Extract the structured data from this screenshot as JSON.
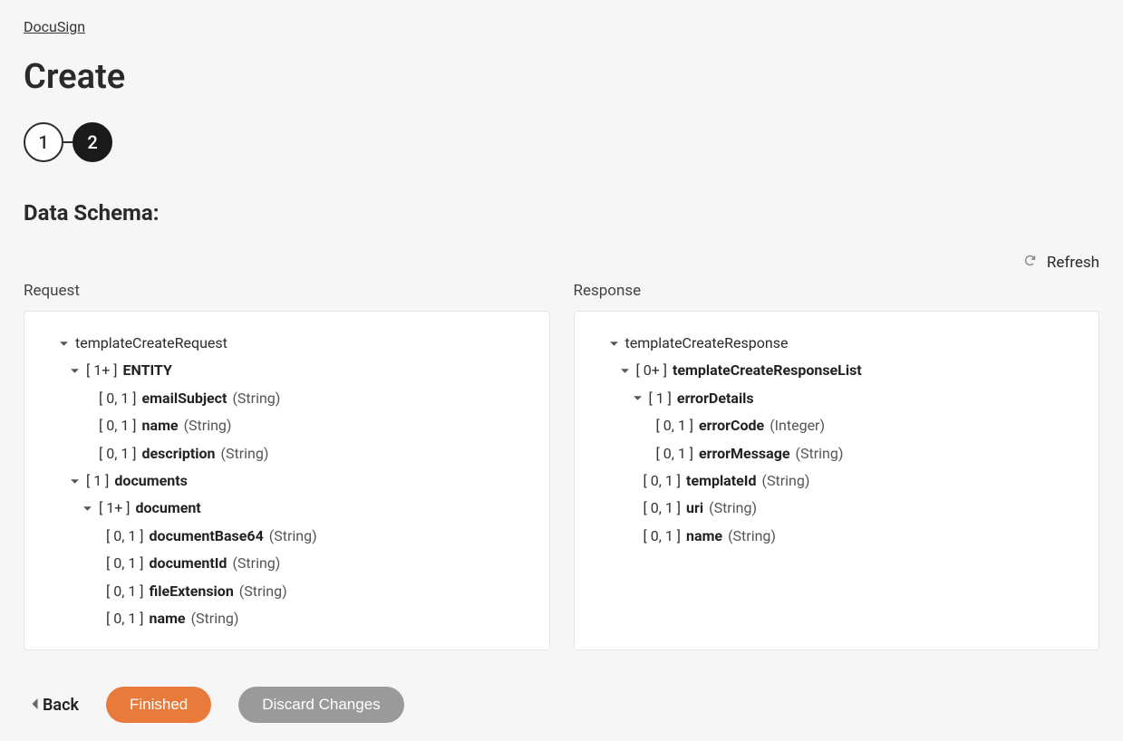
{
  "breadcrumb": "DocuSign",
  "page_title": "Create",
  "steps": [
    "1",
    "2"
  ],
  "section_title": "Data Schema:",
  "refresh_label": "Refresh",
  "columns": {
    "request_label": "Request",
    "response_label": "Response"
  },
  "request_tree": {
    "root": "templateCreateRequest",
    "entity_card": "[ 1+ ]",
    "entity_name": "ENTITY",
    "fields": [
      {
        "card": "[ 0, 1 ]",
        "name": "emailSubject",
        "type": "(String)"
      },
      {
        "card": "[ 0, 1 ]",
        "name": "name",
        "type": "(String)"
      },
      {
        "card": "[ 0, 1 ]",
        "name": "description",
        "type": "(String)"
      }
    ],
    "documents_card": "[ 1 ]",
    "documents_name": "documents",
    "document_card": "[ 1+ ]",
    "document_name": "document",
    "doc_fields": [
      {
        "card": "[ 0, 1 ]",
        "name": "documentBase64",
        "type": "(String)"
      },
      {
        "card": "[ 0, 1 ]",
        "name": "documentId",
        "type": "(String)"
      },
      {
        "card": "[ 0, 1 ]",
        "name": "fileExtension",
        "type": "(String)"
      },
      {
        "card": "[ 0, 1 ]",
        "name": "name",
        "type": "(String)"
      }
    ]
  },
  "response_tree": {
    "root": "templateCreateResponse",
    "list_card": "[ 0+ ]",
    "list_name": "templateCreateResponseList",
    "error_card": "[ 1 ]",
    "error_name": "errorDetails",
    "error_fields": [
      {
        "card": "[ 0, 1 ]",
        "name": "errorCode",
        "type": "(Integer)"
      },
      {
        "card": "[ 0, 1 ]",
        "name": "errorMessage",
        "type": "(String)"
      }
    ],
    "list_fields": [
      {
        "card": "[ 0, 1 ]",
        "name": "templateId",
        "type": "(String)"
      },
      {
        "card": "[ 0, 1 ]",
        "name": "uri",
        "type": "(String)"
      },
      {
        "card": "[ 0, 1 ]",
        "name": "name",
        "type": "(String)"
      }
    ]
  },
  "footer": {
    "back": "Back",
    "finished": "Finished",
    "discard": "Discard Changes"
  }
}
